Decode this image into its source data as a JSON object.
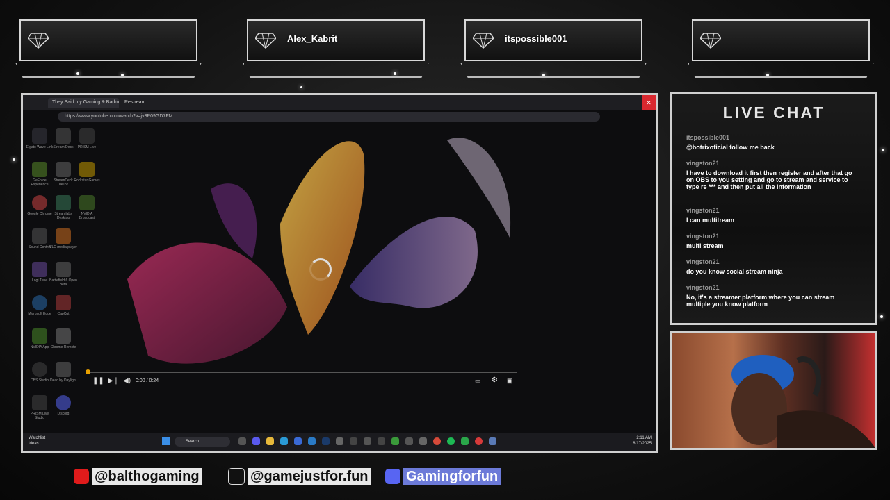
{
  "badges": [
    {
      "name": ""
    },
    {
      "name": "Alex_Kabrit"
    },
    {
      "name": "itspossible001"
    },
    {
      "name": ""
    }
  ],
  "browser": {
    "tabs": [
      "They Said my Gaming & Badmin...",
      "Restream"
    ],
    "url": "https://www.youtube.com/watch?v=jv3P09GD7FM"
  },
  "desktop_icons": [
    "Elgato Wave Link",
    "Stream Deck",
    "PRISM Live",
    "GeForce Experience",
    "StreamDeck TikTok",
    "Rockstar Games",
    "Google Chrome",
    "Streamlabs Desktop",
    "NVIDIA Broadcast",
    "Sound Control",
    "VLC media player",
    "",
    "Logi Tune",
    "Battlefield 6 Open Beta",
    "",
    "Microsoft Edge",
    "CapCut",
    "",
    "NVIDIA App",
    "Chrome Remote",
    "",
    "OBS Studio",
    "Dead by Daylight",
    "",
    "PRISM Live Studio",
    "Discord",
    ""
  ],
  "video": {
    "time": "0:00 / 0:24",
    "progress": 0.0
  },
  "taskbar": {
    "watchlist_title": "Watchlist",
    "watchlist_sub": "Ideas",
    "search": "Search",
    "time": "2:11 AM",
    "date": "8/17/2025"
  },
  "chat": {
    "title": "LIVE CHAT",
    "messages": [
      {
        "user": "itspossible001",
        "text": "@botrixoficial follow me back"
      },
      {
        "user": "vingston21",
        "text": "I have to download it first then register and after that go on OBS to you setting and go to stream and service to type re *** and then put all the information"
      },
      {
        "user": "vingston21",
        "text": "I can multitream"
      },
      {
        "user": "vingston21",
        "text": "multi stream"
      },
      {
        "user": "vingston21",
        "text": "do you know social stream ninja"
      },
      {
        "user": "vingston21",
        "text": "No, it's a streamer platform where you can stream multiple you know platform"
      }
    ]
  },
  "socials": [
    {
      "platform": "youtube-icon",
      "handle": "@balthogaming",
      "color": "#e01b1b"
    },
    {
      "platform": "tiktok-icon",
      "handle": "@gamejustfor.fun",
      "color": "#111111"
    },
    {
      "platform": "discord-icon",
      "handle": "Gamingforfun",
      "color": "#5865f2"
    }
  ],
  "colors": {
    "accent": "#d9282f",
    "frame": "#cfcfcf"
  }
}
